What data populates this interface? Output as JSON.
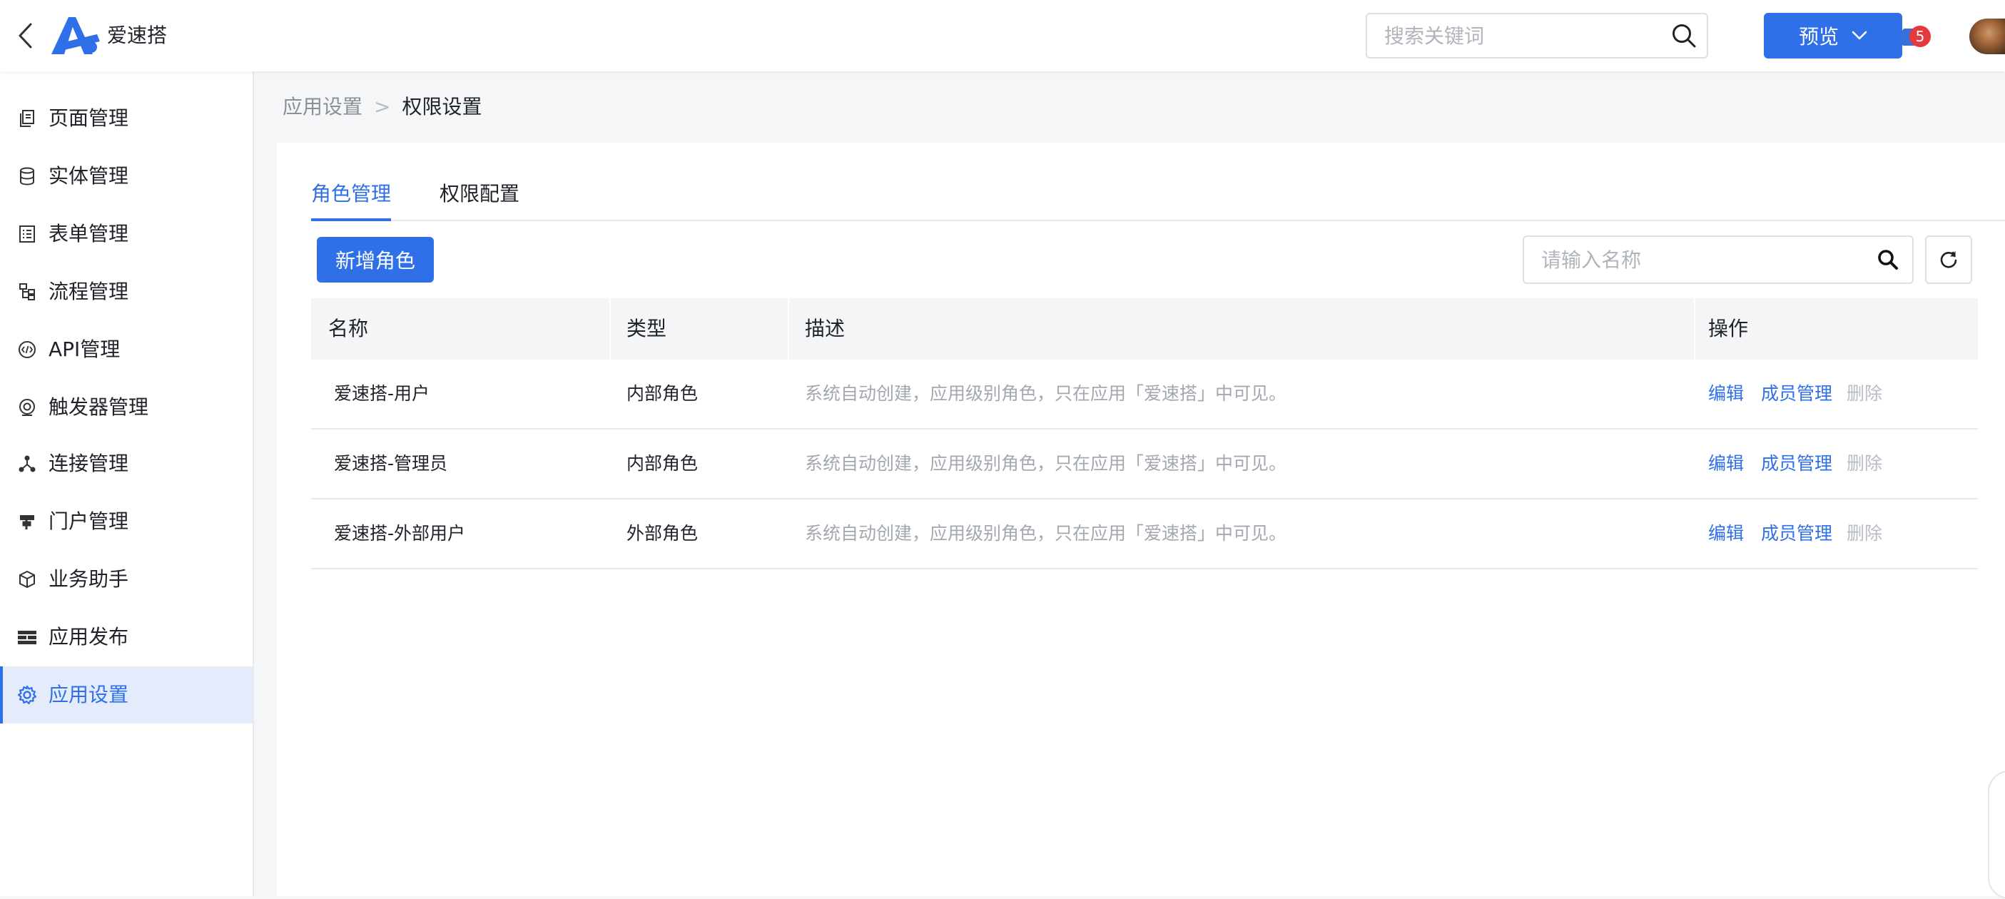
{
  "header": {
    "app_name": "爱速搭",
    "search_placeholder": "搜索关键词",
    "preview_label": "预览",
    "notification_count": "5",
    "colors": {
      "primary": "#2f6fe8",
      "badge": "#e5393e"
    }
  },
  "sidebar": {
    "items": [
      {
        "label": "页面管理",
        "icon": "page-icon"
      },
      {
        "label": "实体管理",
        "icon": "database-icon"
      },
      {
        "label": "表单管理",
        "icon": "form-icon"
      },
      {
        "label": "流程管理",
        "icon": "flow-icon"
      },
      {
        "label": "API管理",
        "icon": "api-icon"
      },
      {
        "label": "触发器管理",
        "icon": "trigger-icon"
      },
      {
        "label": "连接管理",
        "icon": "connection-icon"
      },
      {
        "label": "门户管理",
        "icon": "portal-icon"
      },
      {
        "label": "业务助手",
        "icon": "cube-icon"
      },
      {
        "label": "应用发布",
        "icon": "publish-icon"
      },
      {
        "label": "应用设置",
        "icon": "gear-icon",
        "active": true
      }
    ]
  },
  "breadcrumb": {
    "parent": "应用设置",
    "separator": ">",
    "current": "权限设置"
  },
  "tabs": [
    {
      "label": "角色管理",
      "active": true
    },
    {
      "label": "权限配置",
      "active": false
    }
  ],
  "toolbar": {
    "add_label": "新增角色",
    "search_placeholder": "请输入名称"
  },
  "table": {
    "columns": [
      "名称",
      "类型",
      "描述",
      "操作"
    ],
    "rows": [
      {
        "name": "爱速搭-用户",
        "type": "内部角色",
        "desc": "系统自动创建，应用级别角色，只在应用「爱速搭」中可见。",
        "actions": [
          "编辑",
          "成员管理",
          "删除"
        ]
      },
      {
        "name": "爱速搭-管理员",
        "type": "内部角色",
        "desc": "系统自动创建，应用级别角色，只在应用「爱速搭」中可见。",
        "actions": [
          "编辑",
          "成员管理",
          "删除"
        ]
      },
      {
        "name": "爱速搭-外部用户",
        "type": "外部角色",
        "desc": "系统自动创建，应用级别角色，只在应用「爱速搭」中可见。",
        "actions": [
          "编辑",
          "成员管理",
          "删除"
        ]
      }
    ]
  }
}
